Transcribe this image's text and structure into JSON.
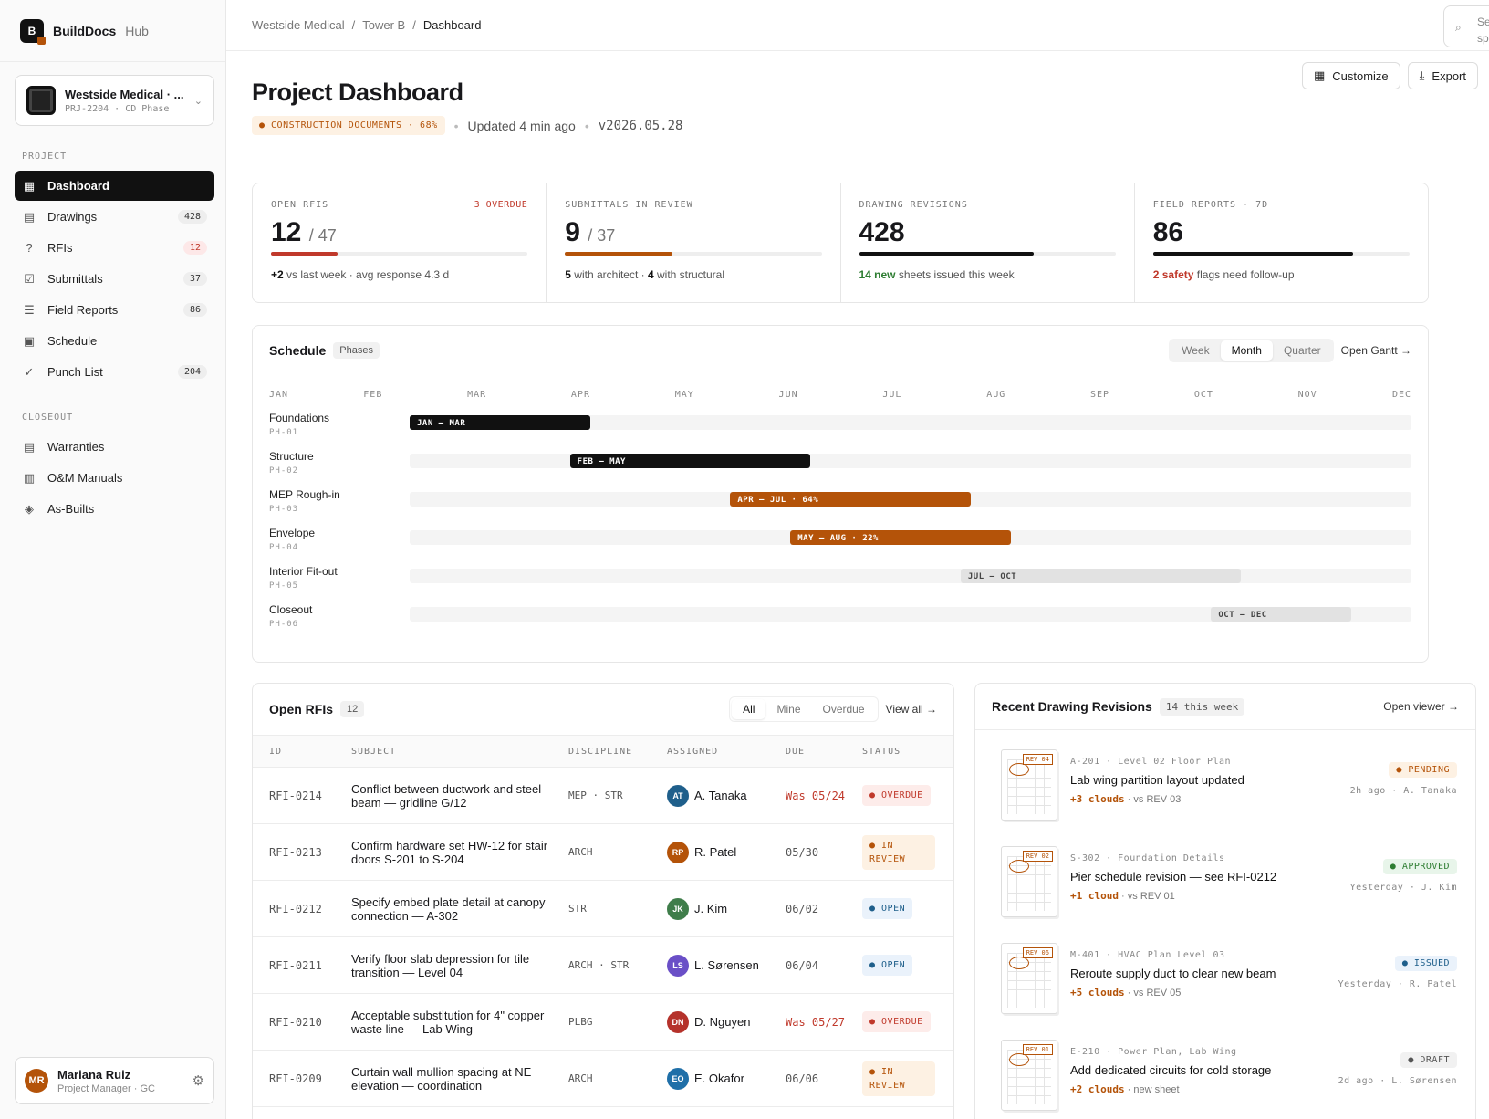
{
  "brand": {
    "name": "BuildDocs",
    "suffix": "Hub",
    "logo_letter": "B"
  },
  "project": {
    "name": "Westside Medical · ...",
    "code": "PRJ-2204 · CD Phase"
  },
  "sidebar": {
    "section_project": "PROJECT",
    "items": [
      {
        "label": "Dashboard",
        "icon": "grid-icon",
        "count": ""
      },
      {
        "label": "Drawings",
        "icon": "file-icon",
        "count": "428"
      },
      {
        "label": "RFIs",
        "icon": "question-icon",
        "count": "12"
      },
      {
        "label": "Submittals",
        "icon": "check-square-icon",
        "count": "37"
      },
      {
        "label": "Field Reports",
        "icon": "list-icon",
        "count": "86"
      },
      {
        "label": "Schedule",
        "icon": "calendar-icon",
        "count": ""
      },
      {
        "label": "Punch List",
        "icon": "checklist-icon",
        "count": "204"
      }
    ],
    "section_closeout": "CLOSEOUT",
    "closeout": [
      {
        "label": "Warranties",
        "icon": "doc-icon"
      },
      {
        "label": "O&M Manuals",
        "icon": "manual-icon"
      },
      {
        "label": "As-Builts",
        "icon": "layers-icon"
      }
    ]
  },
  "user": {
    "initials": "MR",
    "name": "Mariana Ruiz",
    "role": "Project Manager · GC"
  },
  "breadcrumb": [
    "Westside Medical",
    "Tower B",
    "Dashboard"
  ],
  "search": {
    "text": "Sea spe"
  },
  "header": {
    "title": "Project Dashboard",
    "phase": "● CONSTRUCTION DOCUMENTS · 68%",
    "updated": "Updated 4 min ago",
    "version": "v2026.05.28",
    "customize": "Customize",
    "export": "Export"
  },
  "kpis": [
    {
      "label": "OPEN RFIS",
      "warn": "3 OVERDUE",
      "value": "12",
      "total": "/ 47",
      "progress": 0.26,
      "color": "#c0392b",
      "sub_b": "+2",
      "sub": " vs last week · avg response 4.3 d"
    },
    {
      "label": "SUBMITTALS IN REVIEW",
      "warn": "",
      "value": "9",
      "total": "/ 37",
      "progress": 0.42,
      "color": "#b45309",
      "sub_b": "5",
      "sub": " with architect · ",
      "sub_b2": "4",
      "sub2": " with structural"
    },
    {
      "label": "DRAWING REVISIONS",
      "warn": "",
      "value": "428",
      "total": "",
      "progress": 0.68,
      "color": "#111",
      "sub_b": "14 new",
      "sub": " sheets issued this week"
    },
    {
      "label": "FIELD REPORTS · 7D",
      "warn": "",
      "value": "86",
      "total": "",
      "progress": 0.78,
      "color": "#111",
      "sub_b": "2 safety",
      "sub": " flags need follow-up"
    }
  ],
  "schedule": {
    "title": "Schedule",
    "pill": "Phases",
    "views": [
      "Week",
      "Month",
      "Quarter"
    ],
    "active_view": "Month",
    "open_gantt": "Open Gantt →",
    "months": [
      "JAN",
      "FEB",
      "MAR",
      "APR",
      "MAY",
      "JUN",
      "JUL",
      "AUG",
      "SEP",
      "OCT",
      "NOV",
      "DEC"
    ],
    "phases": [
      {
        "name": "Foundations",
        "code": "PH-01",
        "label": "JAN — MAR",
        "start": 0.0,
        "end": 0.18,
        "color": "#111",
        "text": "#fff"
      },
      {
        "name": "Structure",
        "code": "PH-02",
        "label": "FEB — MAY",
        "start": 0.16,
        "end": 0.4,
        "color": "#111",
        "text": "#fff"
      },
      {
        "name": "MEP Rough-in",
        "code": "PH-03",
        "label": "APR — JUL · 64%",
        "start": 0.32,
        "end": 0.56,
        "color": "#b45309",
        "text": "#fff"
      },
      {
        "name": "Envelope",
        "code": "PH-04",
        "label": "MAY — AUG · 22%",
        "start": 0.38,
        "end": 0.6,
        "color": "#b45309",
        "text": "#fff"
      },
      {
        "name": "Interior Fit-out",
        "code": "PH-05",
        "label": "JUL — OCT",
        "start": 0.55,
        "end": 0.83,
        "color": "#e2e2e2",
        "text": "#444"
      },
      {
        "name": "Closeout",
        "code": "PH-06",
        "label": "OCT — DEC",
        "start": 0.8,
        "end": 0.94,
        "color": "#e2e2e2",
        "text": "#444"
      }
    ]
  },
  "rfis": {
    "title": "Open RFIs",
    "count": "12",
    "filters": [
      "All",
      "Mine",
      "Overdue"
    ],
    "active": "All",
    "view_all": "View all →",
    "columns": [
      "ID",
      "SUBJECT",
      "DISCIPLINE",
      "ASSIGNED",
      "DUE",
      "STATUS"
    ],
    "rows": [
      {
        "id": "RFI-0214",
        "subject": "Conflict between ductwork and steel beam — gridline G/12",
        "disc": "MEP · STR",
        "initials": "AT",
        "name": "A. Tanaka",
        "av": "#1f5f8b",
        "due": "Was 05/24",
        "due_red": true,
        "status": "● OVERDUE",
        "st": "overdue"
      },
      {
        "id": "RFI-0213",
        "subject": "Confirm hardware set HW-12 for stair doors S-201 to S-204",
        "disc": "ARCH",
        "initials": "RP",
        "name": "R. Patel",
        "av": "#b45309",
        "due": "05/30",
        "due_red": false,
        "status": "● IN REVIEW",
        "st": "review"
      },
      {
        "id": "RFI-0212",
        "subject": "Specify embed plate detail at canopy connection — A-302",
        "disc": "STR",
        "initials": "JK",
        "name": "J. Kim",
        "av": "#3f7d4a",
        "due": "06/02",
        "due_red": false,
        "status": "● OPEN",
        "st": "open"
      },
      {
        "id": "RFI-0211",
        "subject": "Verify floor slab depression for tile transition — Level 04",
        "disc": "ARCH · STR",
        "initials": "LS",
        "name": "L. Sørensen",
        "av": "#6a4fc7",
        "due": "06/04",
        "due_red": false,
        "status": "● OPEN",
        "st": "open"
      },
      {
        "id": "RFI-0210",
        "subject": "Acceptable substitution for 4\" copper waste line — Lab Wing",
        "disc": "PLBG",
        "initials": "DN",
        "name": "D. Nguyen",
        "av": "#b5322b",
        "due": "Was 05/27",
        "due_red": true,
        "status": "● OVERDUE",
        "st": "overdue"
      },
      {
        "id": "RFI-0209",
        "subject": "Curtain wall mullion spacing at NE elevation — coordination",
        "disc": "ARCH",
        "initials": "EO",
        "name": "E. Okafor",
        "av": "#1f6fa8",
        "due": "06/06",
        "due_red": false,
        "status": "● IN REVIEW",
        "st": "review"
      }
    ]
  },
  "revisions": {
    "title": "Recent Drawing Revisions",
    "pill": "14 this week",
    "open": "Open viewer →",
    "items": [
      {
        "rev": "REV 04",
        "meta": "A-201 · Level 02 Floor Plan",
        "title": "Lab wing partition layout updated",
        "clouds": "+3 clouds",
        "vs": " · vs REV 03",
        "status": "● PENDING",
        "st": "pending",
        "when": "2h ago · A. Tanaka"
      },
      {
        "rev": "REV 02",
        "meta": "S-302 · Foundation Details",
        "title": "Pier schedule revision — see RFI-0212",
        "clouds": "+1 cloud",
        "vs": " · vs REV 01",
        "status": "● APPROVED",
        "st": "approved",
        "when": "Yesterday · J. Kim"
      },
      {
        "rev": "REV 06",
        "meta": "M-401 · HVAC Plan Level 03",
        "title": "Reroute supply duct to clear new beam",
        "clouds": "+5 clouds",
        "vs": " · vs REV 05",
        "status": "● ISSUED",
        "st": "issued",
        "when": "Yesterday · R. Patel"
      },
      {
        "rev": "REV 01",
        "meta": "E-210 · Power Plan, Lab Wing",
        "title": "Add dedicated circuits for cold storage",
        "clouds": "+2 clouds",
        "vs": " · new sheet",
        "status": "● DRAFT",
        "st": "draft",
        "when": "2d ago · L. Sørensen"
      }
    ]
  }
}
